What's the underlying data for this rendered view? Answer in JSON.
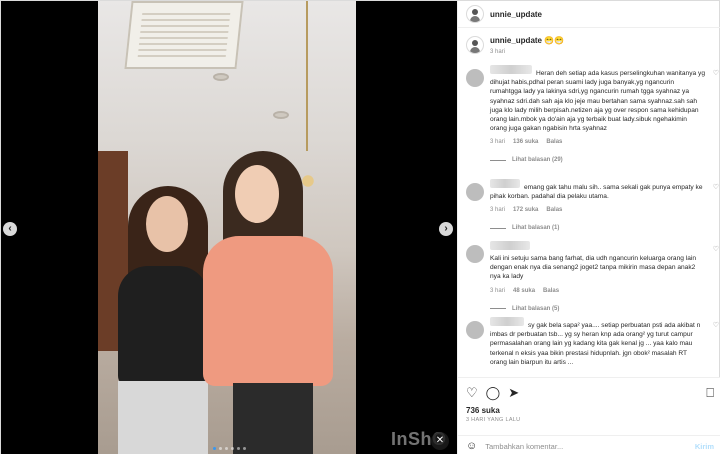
{
  "post": {
    "username": "unnie_update",
    "caption_emoji": "😁😁",
    "caption_age": "3 hari"
  },
  "media": {
    "watermark": "InShO",
    "mute_icon": "speaker-off-icon",
    "prev_icon": "chevron-left-icon",
    "next_icon": "chevron-right-icon"
  },
  "comments": [
    {
      "text": "Heran deh setiap ada kasus perselingkuhan wanitanya yg dihujat habis,pdhal peran suami lady juga banyak,yg ngancurin rumahtgga lady ya lakinya sdri,yg ngancurin rumah tgga syahnaz ya syahnaz sdri.dah sah aja klo jeje mau bertahan sama syahnaz.sah sah juga klo lady milih berpisah.netizen aja yg over respon sama kehidupan orang lain.mbok ya do'ain aja yg terbaik buat lady.sibuk ngehakimin orang juga gakan ngabisin hrta syahnaz",
      "age": "3 hari",
      "likes": "136 suka",
      "reply": "Balas",
      "replies": "Lihat balasan (29)"
    },
    {
      "text": "emang gak tahu malu sih.. sama sekali gak punya empaty ke pihak korban. padahal dia pelaku utama.",
      "age": "3 hari",
      "likes": "172 suka",
      "reply": "Balas",
      "replies": "Lihat balasan (1)"
    },
    {
      "text": "Kali ini setuju sama bang farhat, dia udh ngancurin keluarga orang lain dengan enak nya dia senang2 joget2 tanpa mikirin masa depan anak2 nya ka lady",
      "age": "3 hari",
      "likes": "48 suka",
      "reply": "Balas",
      "replies": "Lihat balasan (5)"
    },
    {
      "text": "sy gak bela sapa² yaa.... setiap perbuatan psti ada akibat n imbas dr perbuatan tsb... yg sy heran knp ada orang² yg turut campur permasalahan orang lain yg kadang kita gak kenal jg ... yaa kalo mau terkenal n eksis yaa bikin prestasi hidupnlah. jgn obok² masalah RT orang lain biarpun itu artis ...",
      "age": "",
      "likes": "",
      "reply": "",
      "replies": ""
    }
  ],
  "actions": {
    "like_icon": "heart-icon",
    "comment_icon": "comment-icon",
    "share_icon": "send-icon",
    "save_icon": "bookmark-icon"
  },
  "likes_count": "736 suka",
  "posted_when": "3 HARI YANG LALU",
  "comment_box": {
    "emoji_icon": "smiley-icon",
    "placeholder": "Tambahkan komentar...",
    "send_label": "Kirim"
  }
}
